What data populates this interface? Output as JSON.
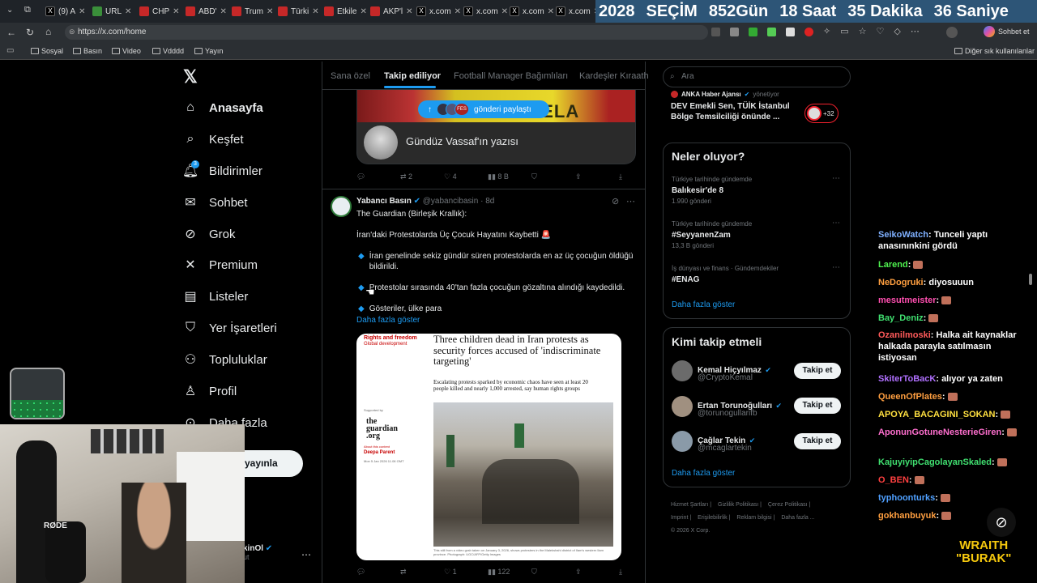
{
  "browser": {
    "tabs": [
      {
        "label": "(9) A"
      },
      {
        "label": "URL"
      },
      {
        "label": "CHP"
      },
      {
        "label": "ABD'"
      },
      {
        "label": "Trum"
      },
      {
        "label": "Türki"
      },
      {
        "label": "Etkile"
      },
      {
        "label": "AKP'l"
      },
      {
        "label": "x.com"
      },
      {
        "label": "x.com"
      },
      {
        "label": "x.com"
      },
      {
        "label": "x.com"
      }
    ],
    "url": "https://x.com/home",
    "profile_button": "Sohbet et",
    "bookmarks": [
      "Sosyal",
      "Basın",
      "Video",
      "Vdddd",
      "Yayın"
    ],
    "bookmarks_right": "Diğer sık kullanılanlar"
  },
  "countdown": {
    "year": "2028",
    "label": "SEÇİM",
    "days": "852",
    "days_label": "Gün",
    "hours": "18",
    "hours_label": "Saat",
    "minutes": "35",
    "minutes_label": "Dakika",
    "seconds": "36",
    "seconds_label": "Saniye"
  },
  "sidebar": {
    "items": [
      {
        "label": "Anasayfa",
        "icon": "home-icon"
      },
      {
        "label": "Keşfet",
        "icon": "search-icon"
      },
      {
        "label": "Bildirimler",
        "icon": "bell-icon",
        "badge": "3"
      },
      {
        "label": "Sohbet",
        "icon": "mail-icon"
      },
      {
        "label": "Grok",
        "icon": "grok-icon"
      },
      {
        "label": "Premium",
        "icon": "x-logo-icon"
      },
      {
        "label": "Listeler",
        "icon": "list-icon"
      },
      {
        "label": "Yer İşaretleri",
        "icon": "bookmark-icon"
      },
      {
        "label": "Topluluklar",
        "icon": "people-icon"
      },
      {
        "label": "Profil",
        "icon": "person-icon"
      },
      {
        "label": "Daha fazla",
        "icon": "more-icon"
      }
    ],
    "post_button": "yayınla",
    "account_name": "kinOl",
    "account_handle": "ut"
  },
  "feed": {
    "tabs": [
      "Sana özel",
      "Takip ediliyor",
      "Football Manager Bağımlıları",
      "Kardeşler Kıraath"
    ],
    "share_pill": "gönderi paylaştı",
    "pill_badge": "FES",
    "top_card_text": "Gündüz Vassaf'ın yazısı",
    "banner_text": "VENEZUELA",
    "post1_actions": {
      "replies": "",
      "reposts": "2",
      "likes": "4",
      "views": "8 B"
    },
    "post2": {
      "author": "Yabancı Basın",
      "handle": "@yabancibasin",
      "time": "8d",
      "line1": "The Guardian (Birleşik Krallık):",
      "line2": "İran'daki Protestolarda Üç Çocuk Hayatını Kaybetti 🚨",
      "bullet1": "İran genelinde sekiz gündür süren protestolarda en az üç çocuğun öldüğü bildirildi.",
      "bullet2": "Protestolar sırasında 40'tan fazla çocuğun gözaltına alındığı kaydedildi.",
      "bullet3": "Gösteriler, ülke para",
      "show_more": "Daha fazla göster",
      "article": {
        "section1": "Rights and freedom",
        "section2": "Global development",
        "headline": "Three children dead in Iran protests as security forces accused of 'indiscriminate targeting'",
        "standfirst": "Escalating protests sparked by economic chaos have seen at least 20 people killed and nearly 1,000 arrested, say human rights groups",
        "supported": "Supported by",
        "brand1": "the",
        "brand2": "guardian",
        "brand3": ".org",
        "about": "About this content",
        "byline": "Deepa Parent",
        "date": "Mon 5 Jan 2026 11.06 GMT",
        "caption": "This still from a video grab taken on January 3, 2026, shows protesters in the Malekshahi district of Ilam's western Ilam province. Photograph: UGC/AFP/Getty Images"
      },
      "actions": {
        "replies": "",
        "reposts": "",
        "likes": "1",
        "views": "122"
      }
    }
  },
  "right": {
    "search_placeholder": "Ara",
    "live": {
      "source": "ANKA Haber Ajansı",
      "role": "yönetiyor",
      "title": "DEV Emekli Sen, TÜİK İstanbul Bölge Temsilciliği önünde ...",
      "count": "+32"
    },
    "trends_title": "Neler oluyor?",
    "trends": [
      {
        "context": "Türkiye tarihinde gündemde",
        "name": "Balıkesir'de 8",
        "count": "1.990 gönderi"
      },
      {
        "context": "Türkiye tarihinde gündemde",
        "name": "#SeyyanenZam",
        "count": "13,3 B gönderi"
      },
      {
        "context": "İş dünyası ve finans · Gündemdekiler",
        "name": "#ENAG",
        "count": ""
      }
    ],
    "show_more": "Daha fazla göster",
    "wtf_title": "Kimi takip etmeli",
    "who_to_follow": [
      {
        "name": "Kemal Hiçyılmaz",
        "handle": "@CryptoKemal",
        "button": "Takip et"
      },
      {
        "name": "Ertan Torunoğulları",
        "handle": "@torunogullarifb",
        "button": "Takip et"
      },
      {
        "name": "Çağlar Tekin",
        "handle": "@mcaglartekin",
        "button": "Takip et"
      }
    ],
    "wtf_more": "Daha fazla göster",
    "footer": [
      "Hizmet Şartları",
      "Gizlilik Politikası",
      "Çerez Politikası",
      "Imprint",
      "Erişilebilirlik",
      "Reklam bilgisi",
      "Daha fazla ...",
      "© 2026 X Corp."
    ]
  },
  "chat": [
    {
      "user": "SeikoWatch",
      "color": "#7fb0ff",
      "msg": "Tunceli yaptı anasınınkini gördü"
    },
    {
      "user": "Larend",
      "color": "#4ff14f",
      "msg": ""
    },
    {
      "user": "NeDogruki",
      "color": "#ff9f40",
      "msg": "diyosuuun"
    },
    {
      "user": "mesutmeister",
      "color": "#ff4fb0",
      "msg": ""
    },
    {
      "user": "Bay_Deniz",
      "color": "#40e070",
      "msg": ""
    },
    {
      "user": "Ozanilmoski",
      "color": "#ff5a5a",
      "msg": "Halka ait kaynaklar halkada parayla satılmasın istiyosan"
    },
    {
      "user": "SkiterToBacK",
      "color": "#b070ff",
      "msg": "alıyor ya zaten"
    },
    {
      "user": "QueenOfPlates",
      "color": "#ff9f40",
      "msg": ""
    },
    {
      "user": "APOYA_BACAGINI_SOKAN",
      "color": "#ffe040",
      "msg": ""
    },
    {
      "user": "AponunGotuneNesterieGiren",
      "color": "#ff6fcf",
      "msg": ""
    },
    {
      "user": "KajuyiyipCagolayanSkaled",
      "color": "#40e070",
      "msg": ""
    },
    {
      "user": "O_BEN",
      "color": "#ff4040",
      "msg": ""
    },
    {
      "user": "typhoonturks",
      "color": "#4fa0ff",
      "msg": ""
    },
    {
      "user": "gokhanbuyuk",
      "color": "#ff9f40",
      "msg": ""
    }
  ],
  "overlay": {
    "brand_line1": "WRAITH",
    "brand_line2": "\"BURAK\"",
    "cap_text": "RØDE"
  }
}
